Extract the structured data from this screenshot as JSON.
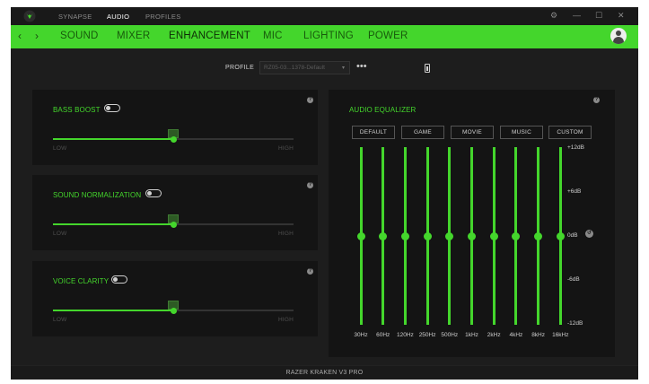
{
  "topbar": {
    "tabs": [
      "SYNAPSE",
      "AUDIO",
      "PROFILES"
    ],
    "active_tab": "AUDIO",
    "window_buttons": [
      "⚙",
      "—",
      "☐",
      "✕"
    ]
  },
  "nav": {
    "tabs": [
      "SOUND",
      "MIXER",
      "ENHANCEMENT",
      "MIC",
      "LIGHTING",
      "POWER"
    ],
    "active_tab": "ENHANCEMENT",
    "back_icon": "‹",
    "forward_icon": "›"
  },
  "profile": {
    "label": "PROFILE",
    "selected": "RZ05-03...1378-Default",
    "more_label": "•••"
  },
  "enhancements": [
    {
      "title": "BASS BOOST",
      "enabled": false,
      "level": 0.5,
      "low_label": "LOW",
      "high_label": "HIGH"
    },
    {
      "title": "SOUND NORMALIZATION",
      "enabled": false,
      "level": 0.5,
      "low_label": "LOW",
      "high_label": "HIGH"
    },
    {
      "title": "VOICE CLARITY",
      "enabled": false,
      "level": 0.5,
      "low_label": "LOW",
      "high_label": "HIGH"
    }
  ],
  "equalizer": {
    "title": "AUDIO EQUALIZER",
    "presets": [
      "DEFAULT",
      "GAME",
      "MOVIE",
      "MUSIC",
      "CUSTOM"
    ],
    "active_preset": "DEFAULT",
    "bands": [
      {
        "freq": "30Hz",
        "gain_db": 0
      },
      {
        "freq": "60Hz",
        "gain_db": 0
      },
      {
        "freq": "120Hz",
        "gain_db": 0
      },
      {
        "freq": "250Hz",
        "gain_db": 0
      },
      {
        "freq": "500Hz",
        "gain_db": 0
      },
      {
        "freq": "1kHz",
        "gain_db": 0
      },
      {
        "freq": "2kHz",
        "gain_db": 0
      },
      {
        "freq": "4kHz",
        "gain_db": 0
      },
      {
        "freq": "8kHz",
        "gain_db": 0
      },
      {
        "freq": "16kHz",
        "gain_db": 0
      }
    ],
    "db_labels": [
      "+12dB",
      "+6dB",
      "0dB",
      "-6dB",
      "-12dB"
    ],
    "db_range": [
      -12,
      12
    ]
  },
  "footer": {
    "device_name": "RAZER KRAKEN V3 PRO"
  },
  "colors": {
    "accent": "#44d62c",
    "background": "#1d1d1d",
    "panel": "#141414"
  },
  "help_glyph": "?",
  "reset_glyph": "↺"
}
